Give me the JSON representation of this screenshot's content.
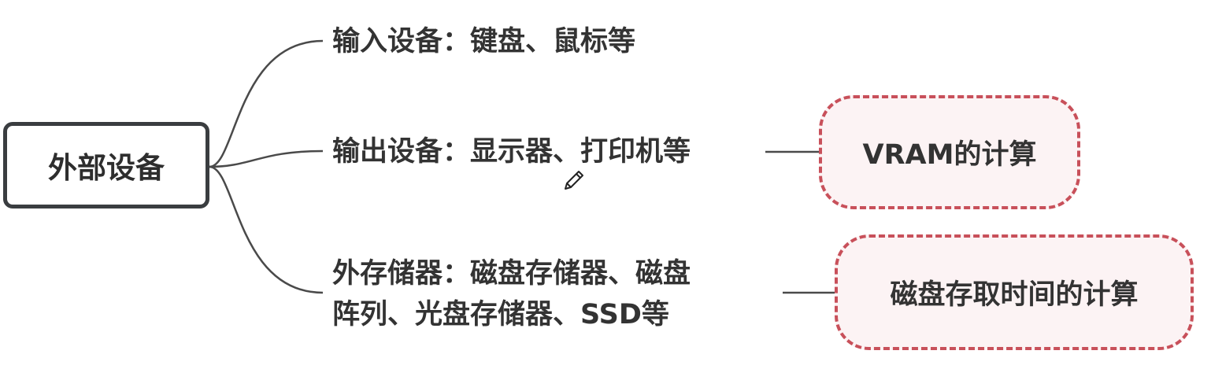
{
  "root": {
    "label": "外部设备"
  },
  "branches": [
    {
      "label": "输入设备：键盘、鼠标等"
    },
    {
      "label": "输出设备：显示器、打印机等",
      "note": "VRAM的计算"
    },
    {
      "label_line1": "外存储器：磁盘存储器、磁盘",
      "label_line2": "阵列、光盘存储器、SSD等",
      "note": "磁盘存取时间的计算"
    }
  ],
  "colors": {
    "root_border": "#3a3d40",
    "connector": "#4a4a4a",
    "note_border": "#c8505a",
    "note_fill": "#fcf3f4",
    "text": "#333333"
  },
  "icons": {
    "cursor": "pencil-icon"
  }
}
